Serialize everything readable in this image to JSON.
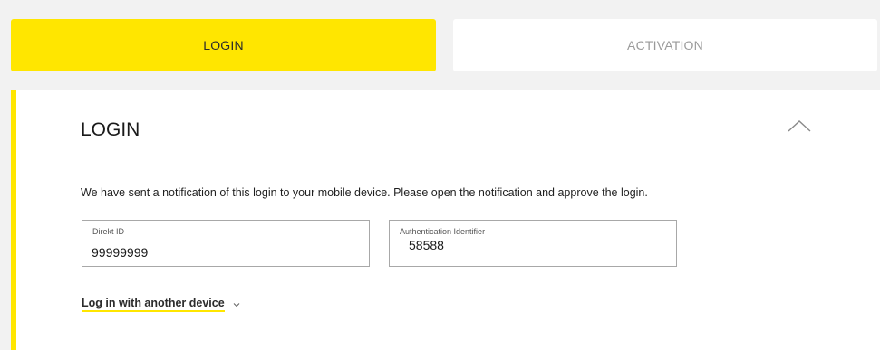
{
  "tabs": [
    {
      "label": "LOGIN",
      "active": true
    },
    {
      "label": "ACTIVATION",
      "active": false
    }
  ],
  "panel": {
    "title": "LOGIN",
    "collapse_icon": "chevron-up-icon",
    "message": "We have sent a notification of this login to your mobile device. Please open the notification and approve the login.",
    "fields": {
      "direkt_id": {
        "label": "Direkt ID",
        "value": "99999999"
      },
      "auth_identifier": {
        "label": "Authentication Identifier",
        "value": "58588"
      }
    },
    "another_device": {
      "label": "Log in with another device",
      "icon": "chevron-down-icon"
    }
  },
  "colors": {
    "accent": "#ffe600",
    "background": "#f2f2f2",
    "inactive_tab_text": "#9a9a9a"
  }
}
